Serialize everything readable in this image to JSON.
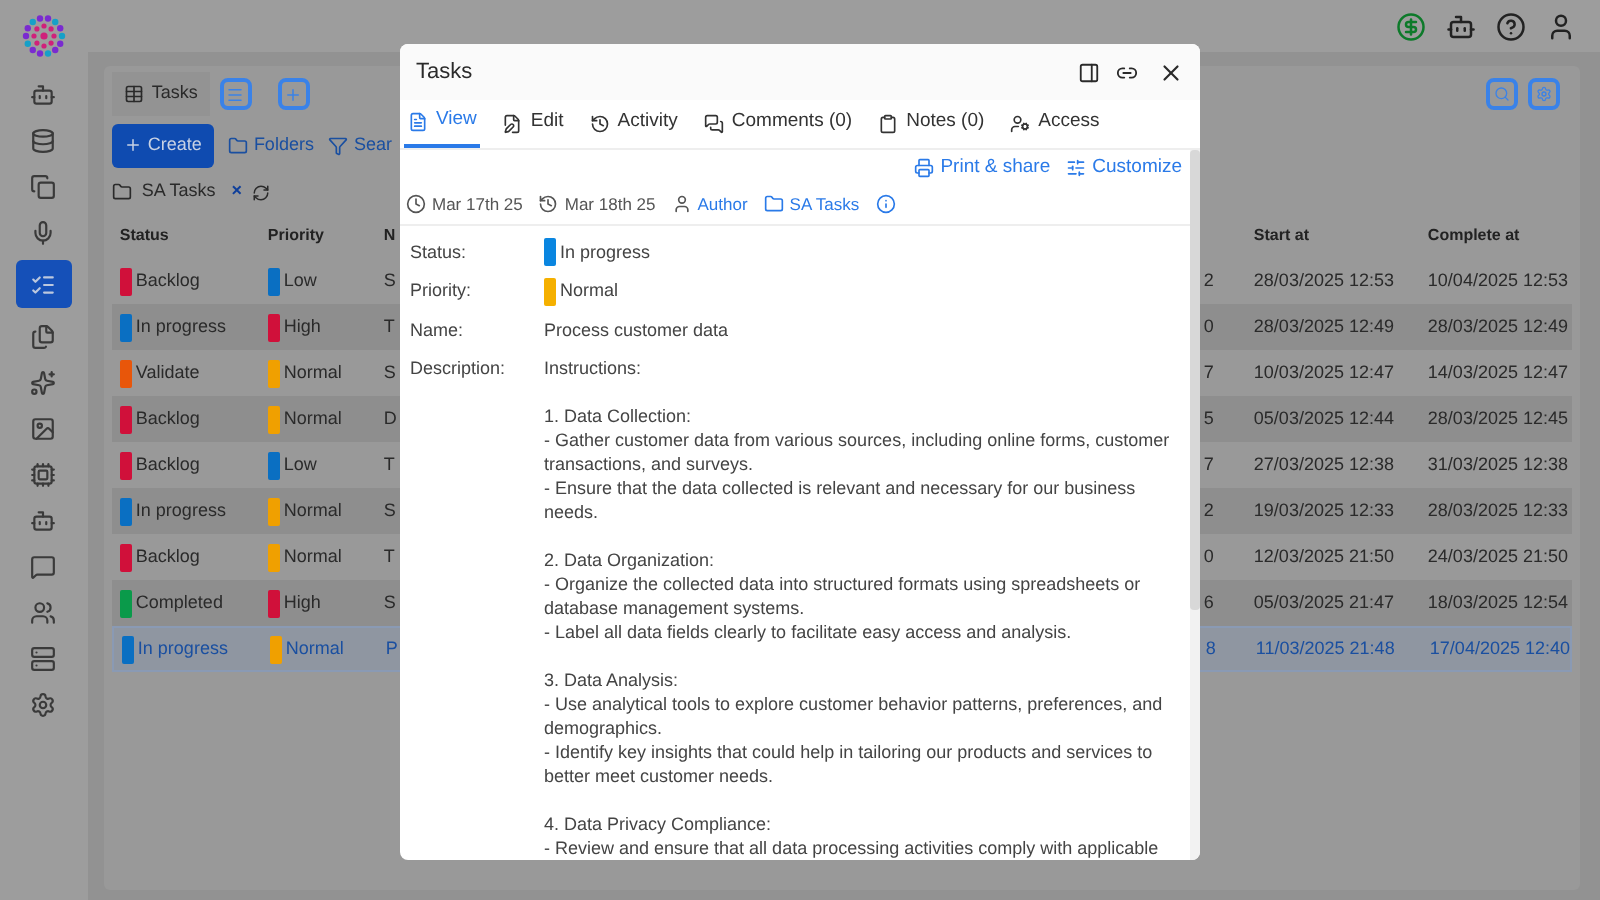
{
  "sidebar": {
    "items": [
      {
        "selected": false
      },
      {
        "selected": false
      },
      {
        "selected": false
      },
      {
        "selected": false
      },
      {
        "selected": true
      },
      {
        "selected": false
      },
      {
        "selected": false
      },
      {
        "selected": false
      },
      {
        "selected": false
      },
      {
        "selected": false
      },
      {
        "selected": false
      },
      {
        "selected": false
      },
      {
        "selected": false
      },
      {
        "selected": false
      }
    ]
  },
  "list_tab": {
    "label": "Tasks"
  },
  "toolbar": {
    "create": "Create",
    "folders": "Folders",
    "search": "Sear"
  },
  "breadcrumb": {
    "folder": "SA Tasks",
    "clear": "×"
  },
  "table": {
    "columns": [
      "Status",
      "Priority",
      "N",
      "Start at",
      "Complete at"
    ],
    "rows": [
      {
        "status": {
          "label": "Backlog",
          "color": "#d0103a"
        },
        "priority": {
          "label": "Low",
          "color": "#0a6fc2"
        },
        "name": "S",
        "column_4": "2",
        "start_at": "28/03/2025 12:53",
        "complete_at": "10/04/2025 12:53",
        "selected": false
      },
      {
        "status": {
          "label": "In progress",
          "color": "#0a6fc2"
        },
        "priority": {
          "label": "High",
          "color": "#d0103a"
        },
        "name": "T",
        "column_4": "0",
        "start_at": "28/03/2025 12:49",
        "complete_at": "28/03/2025 12:49",
        "selected": false
      },
      {
        "status": {
          "label": "Validate",
          "color": "#e8560a"
        },
        "priority": {
          "label": "Normal",
          "color": "#f0a000"
        },
        "name": "S",
        "column_4": "7",
        "start_at": "10/03/2025 12:47",
        "complete_at": "14/03/2025 12:47",
        "selected": false
      },
      {
        "status": {
          "label": "Backlog",
          "color": "#d0103a"
        },
        "priority": {
          "label": "Normal",
          "color": "#f0a000"
        },
        "name": "D",
        "column_4": "5",
        "start_at": "05/03/2025 12:44",
        "complete_at": "28/03/2025 12:45",
        "selected": false
      },
      {
        "status": {
          "label": "Backlog",
          "color": "#d0103a"
        },
        "priority": {
          "label": "Low",
          "color": "#0a6fc2"
        },
        "name": "T",
        "column_4": "7",
        "start_at": "27/03/2025 12:38",
        "complete_at": "31/03/2025 12:38",
        "selected": false
      },
      {
        "status": {
          "label": "In progress",
          "color": "#0a6fc2"
        },
        "priority": {
          "label": "Normal",
          "color": "#f0a000"
        },
        "name": "S",
        "column_4": "2",
        "start_at": "19/03/2025 12:33",
        "complete_at": "28/03/2025 12:33",
        "selected": false
      },
      {
        "status": {
          "label": "Backlog",
          "color": "#d0103a"
        },
        "priority": {
          "label": "Normal",
          "color": "#f0a000"
        },
        "name": "T",
        "column_4": "0",
        "start_at": "12/03/2025 21:50",
        "complete_at": "24/03/2025 21:50",
        "selected": false
      },
      {
        "status": {
          "label": "Completed",
          "color": "#0a9a4a"
        },
        "priority": {
          "label": "High",
          "color": "#d0103a"
        },
        "name": "S",
        "column_4": "6",
        "start_at": "05/03/2025 21:47",
        "complete_at": "18/03/2025 12:54",
        "selected": false
      },
      {
        "status": {
          "label": "In progress",
          "color": "#0a6fc2"
        },
        "priority": {
          "label": "Normal",
          "color": "#f0a000"
        },
        "name": "P",
        "column_4": "8",
        "start_at": "11/03/2025 21:48",
        "complete_at": "17/04/2025 12:40",
        "selected": true
      }
    ]
  },
  "dialog": {
    "title": "Tasks",
    "tabs": [
      {
        "label": "View",
        "selected": true
      },
      {
        "label": "Edit",
        "selected": false
      },
      {
        "label": "Activity",
        "selected": false
      },
      {
        "label": "Comments (0)",
        "selected": false
      },
      {
        "label": "Notes (0)",
        "selected": false
      },
      {
        "label": "Access",
        "selected": false
      }
    ],
    "actions": [
      "Print & share",
      "Customize"
    ],
    "meta": {
      "created": "Mar 17th 25",
      "updated": "Mar 18th 25",
      "author": "Author",
      "folder": "SA Tasks"
    },
    "fields": [
      {
        "label": "Status:",
        "kind": "tag",
        "value": "In progress",
        "color": "#0a86e0"
      },
      {
        "label": "Priority:",
        "kind": "tag",
        "value": "Normal",
        "color": "#f5b000"
      },
      {
        "label": "Name:",
        "kind": "text",
        "value": "Process customer data"
      }
    ],
    "description": {
      "label": "Description:",
      "blocks": [
        [
          "Instructions:"
        ],
        [
          "1. Data Collection:",
          "- Gather customer data from various sources, including online forms, customer transactions, and surveys.",
          "- Ensure that the data collected is relevant and necessary for our business needs."
        ],
        [
          "2. Data Organization:",
          "- Organize the collected data into structured formats using spreadsheets or database management systems.",
          "- Label all data fields clearly to facilitate easy access and analysis."
        ],
        [
          "3. Data Analysis:",
          "- Use analytical tools to explore customer behavior patterns, preferences, and demographics.",
          "- Identify key insights that could help in tailoring our products and services to better meet customer needs."
        ],
        [
          "4. Data Privacy Compliance:",
          "- Review and ensure that all data processing activities comply with applicable"
        ]
      ]
    }
  }
}
